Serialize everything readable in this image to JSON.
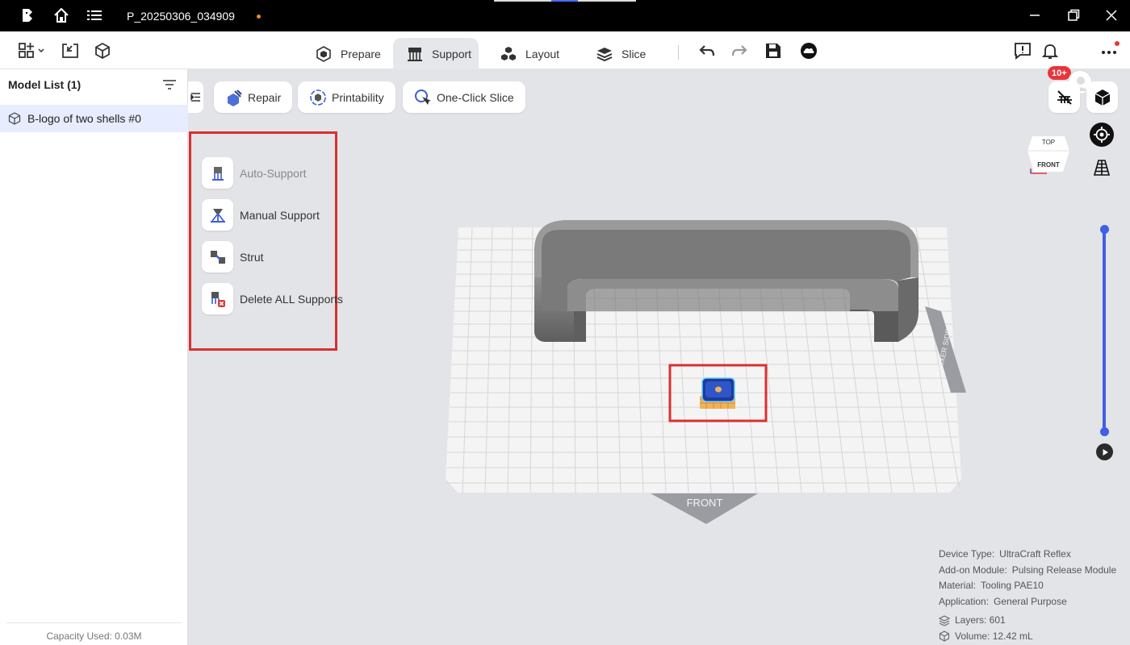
{
  "titlebar": {
    "project_name": "P_20250306_034909",
    "icons": [
      "app-logo-icon",
      "home-icon",
      "menu-list-icon"
    ],
    "window_controls": [
      "minimize-icon",
      "restore-icon",
      "close-icon"
    ]
  },
  "toolbar": {
    "left_icons": [
      "grid-apps-icon",
      "import-icon",
      "model-cube-icon"
    ],
    "tabs": [
      {
        "label": "Prepare",
        "active": false
      },
      {
        "label": "Support",
        "active": true
      },
      {
        "label": "Layout",
        "active": false
      },
      {
        "label": "Slice",
        "active": false
      }
    ],
    "right_icons": [
      "undo-icon",
      "redo-icon",
      "save-icon",
      "cloud-icon",
      "feedback-icon",
      "bell-icon",
      "more-icon"
    ],
    "notification_badge": "10+"
  },
  "model_list": {
    "title": "Model List (1)",
    "items": [
      "B-logo of two shells #0"
    ],
    "capacity": "Capacity Used: 0.03M"
  },
  "actions": {
    "repair": "Repair",
    "printability": "Printability",
    "one_click_slice": "One-Click Slice"
  },
  "support_menu": {
    "items": [
      {
        "label": "Auto-Support",
        "disabled": true
      },
      {
        "label": "Manual Support",
        "disabled": false
      },
      {
        "label": "Strut",
        "disabled": false
      },
      {
        "label": "Delete ALL Supports",
        "disabled": false
      }
    ]
  },
  "viewport": {
    "view_cube_top": "TOP",
    "view_cube_front": "FRONT",
    "bed_front_label": "FRONT",
    "mixer_side_label": "MIXER SIDE"
  },
  "info": {
    "device_type_label": "Device Type:",
    "device_type": "UltraCraft Reflex",
    "addon_label": "Add-on Module:",
    "addon": "Pulsing Release Module",
    "material_label": "Material:",
    "material": "Tooling PAE10",
    "application_label": "Application:",
    "application": "General Purpose",
    "layers": "Layers: 601",
    "volume": "Volume: 12.42 mL"
  },
  "colors": {
    "accent_blue": "#3f5fe6",
    "highlight_red": "#d8312f",
    "badge_red": "#e8353b"
  }
}
